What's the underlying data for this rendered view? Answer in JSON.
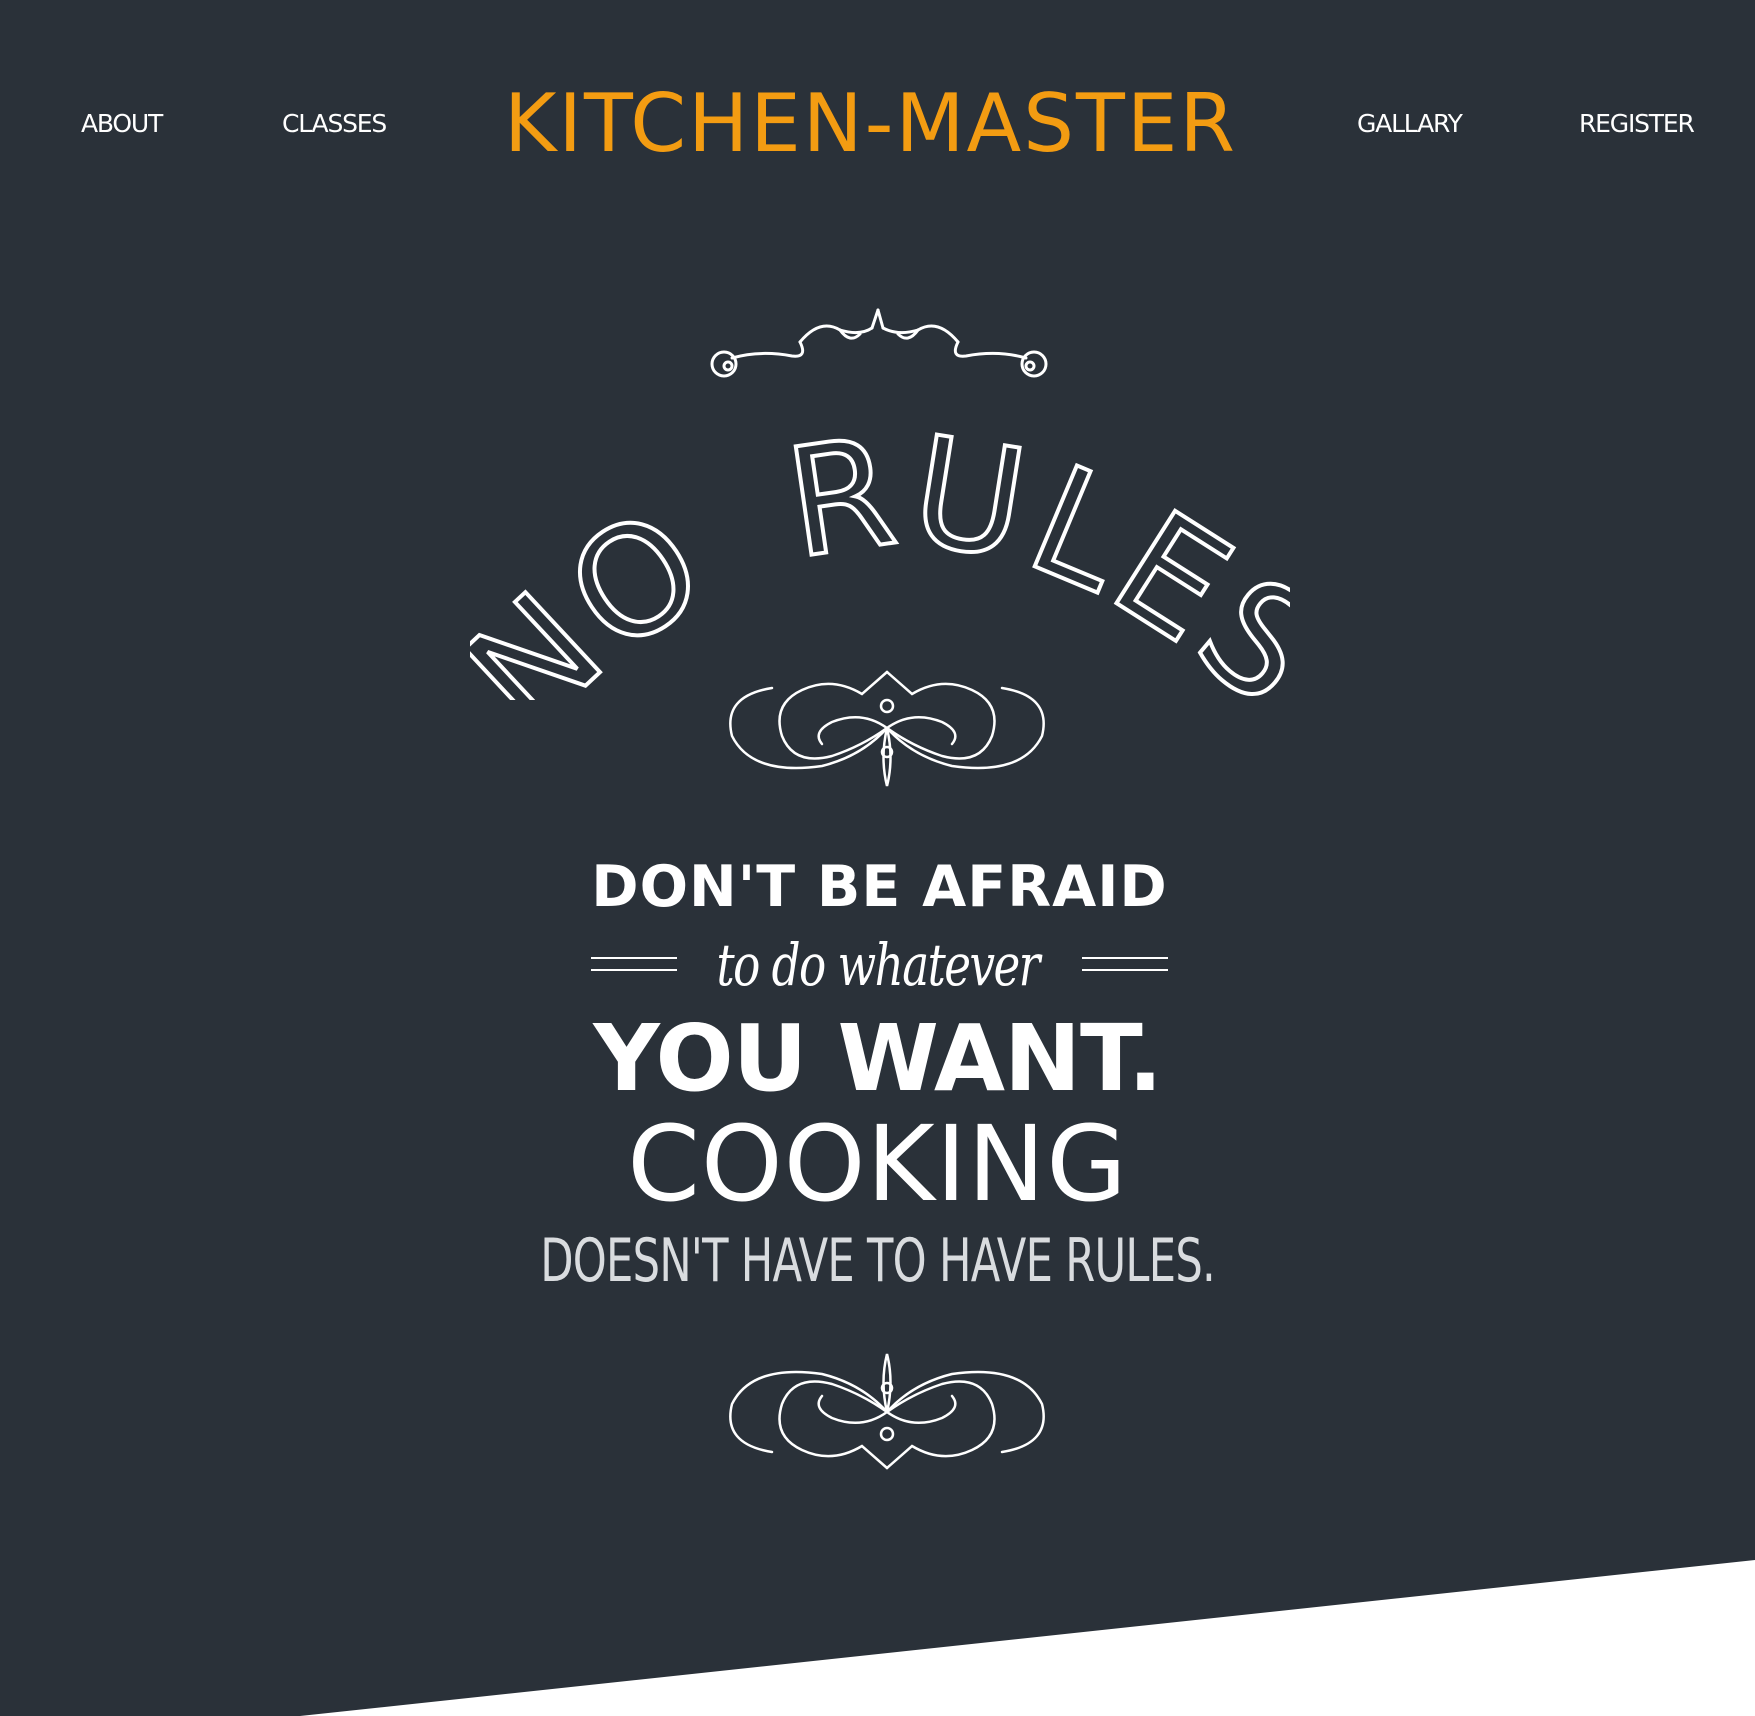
{
  "header": {
    "nav_left": [
      "ABOUT",
      "CLASSES"
    ],
    "brand": "KITCHEN-MASTER",
    "nav_right": [
      "GALLARY",
      "REGISTER"
    ]
  },
  "hero": {
    "arc_line_1": "NO",
    "arc_line_2": "RULES",
    "line_afraid": "DON'T BE AFRAID",
    "line_whatever": "to do whatever",
    "line_want": "YOU WANT.",
    "line_cooking": "COOKING",
    "line_rules": "DOESN'T HAVE TO HAVE RULES."
  },
  "colors": {
    "background": "#2a3139",
    "brand": "#f39c12",
    "text": "#ffffff",
    "bottom_panel": "#ffffff"
  }
}
